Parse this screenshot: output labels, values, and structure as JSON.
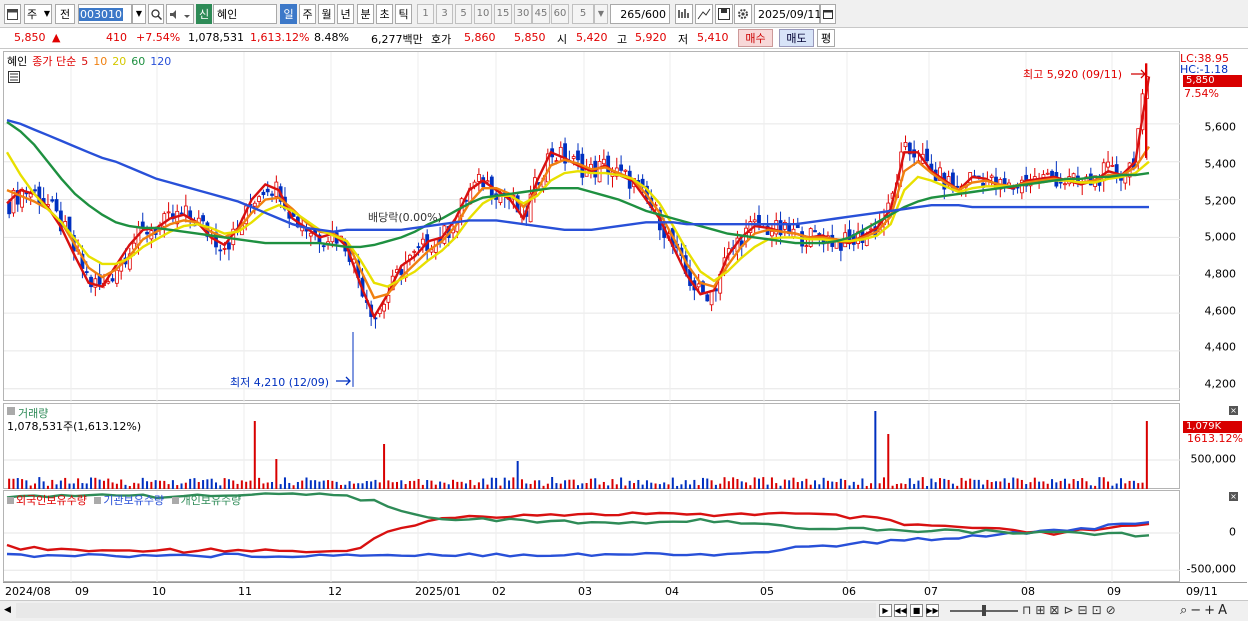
{
  "toolbar": {
    "period_sel": "주",
    "kind": "전",
    "code": "003010",
    "name": "혜인",
    "mode_new": "신",
    "periods": [
      "일",
      "주",
      "월",
      "년",
      "분",
      "초",
      "틱"
    ],
    "minutes": [
      "1",
      "3",
      "5",
      "10",
      "15",
      "30",
      "45",
      "60"
    ],
    "interval": "5",
    "count": "265",
    "count_max": "/600",
    "date": "2025/09/11"
  },
  "quote": {
    "price": "5,850",
    "arrow": "▲",
    "change": "410",
    "pct": "+7.54%",
    "volume": "1,078,531",
    "vol_pct": "1,613.12%",
    "turnover": "8.48%",
    "amount": "6,277백만",
    "ask_label": "호가",
    "ask": "5,860",
    "bid": "5,850",
    "open_label": "시",
    "open": "5,420",
    "high_label": "고",
    "high": "5,920",
    "low_label": "저",
    "low": "5,410",
    "buy_label": "매수",
    "sell_label": "매도",
    "avg_label": "평"
  },
  "price_panel": {
    "name": "혜인",
    "ma_label": "종가 단순",
    "ma_periods": [
      "5",
      "10",
      "20",
      "60",
      "120"
    ],
    "ma_colors": [
      "#d81010",
      "#f08010",
      "#e8e000",
      "#1e9040",
      "#2850d8"
    ],
    "high_annot": "최고 5,920 (09/11)",
    "low_annot": "최저 4,210 (12/09)",
    "div_annot": "배당락(0.00%)",
    "lc": "LC:38.95",
    "hc": "HC:-1.18",
    "last_tag": "5,850",
    "last_pct": "7.54%",
    "y_ticks": [
      "5,600",
      "5,400",
      "5,200",
      "5,000",
      "4,800",
      "4,600",
      "4,400",
      "4,200"
    ]
  },
  "volume_panel": {
    "title": "거래량",
    "value": "1,078,531주(1,613.12%)",
    "tag": "1,079K",
    "tag_pct": "1613.12%",
    "y_ticks": [
      "500,000"
    ]
  },
  "holdings_panel": {
    "legends": [
      "외국인보유수량",
      "기관보유수량",
      "개인보유수량"
    ],
    "colors": [
      "#d81010",
      "#2850d8",
      "#2e8b57"
    ],
    "y_ticks": [
      "0",
      "-500,000"
    ]
  },
  "x_axis": [
    "2024/08",
    "09",
    "10",
    "11",
    "12",
    "2025/01",
    "02",
    "03",
    "04",
    "05",
    "06",
    "07",
    "08",
    "09",
    "09/11"
  ],
  "colors": {
    "up": "#e00000",
    "down": "#0030c0",
    "accent_blue": "#3c78c8"
  },
  "chart_data": {
    "type": "candlestick",
    "x_range": [
      "2024/08",
      "2025/09/11"
    ],
    "y_range": [
      4130,
      5980
    ],
    "last_close": 5850,
    "high": {
      "value": 5920,
      "date": "09/11"
    },
    "low": {
      "value": 4210,
      "date": "12/09"
    },
    "ma_series": [
      {
        "name": "5",
        "color": "#d81010",
        "values": [
          5180,
          5250,
          5230,
          5160,
          5050,
          4900,
          4760,
          4740,
          4850,
          4960,
          5040,
          5050,
          5100,
          5120,
          5080,
          5000,
          4960,
          5050,
          5200,
          5280,
          5250,
          5100,
          5050,
          5000,
          5020,
          4950,
          4750,
          4580,
          4700,
          4850,
          4900,
          4980,
          5000,
          5100,
          5250,
          5300,
          5250,
          5200,
          5100,
          5300,
          5450,
          5420,
          5380,
          5350,
          5380,
          5330,
          5300,
          5200,
          5100,
          4950,
          4800,
          4700,
          4720,
          4900,
          5000,
          5060,
          5050,
          5030,
          5020,
          5000,
          5010,
          4980,
          4970,
          5010,
          5050,
          5150,
          5450,
          5450,
          5350,
          5300,
          5250,
          5320,
          5310,
          5270,
          5260,
          5300,
          5310,
          5320,
          5300,
          5280,
          5300,
          5350,
          5330,
          5400,
          5850
        ]
      },
      {
        "name": "10",
        "color": "#f08010",
        "values": [
          5250,
          5220,
          5190,
          5150,
          5080,
          4960,
          4840,
          4790,
          4830,
          4900,
          4990,
          5030,
          5070,
          5090,
          5080,
          5030,
          5000,
          5040,
          5130,
          5200,
          5210,
          5150,
          5080,
          5030,
          5020,
          4980,
          4830,
          4680,
          4700,
          4790,
          4860,
          4930,
          4980,
          5060,
          5180,
          5260,
          5260,
          5230,
          5160,
          5250,
          5380,
          5410,
          5390,
          5360,
          5370,
          5340,
          5310,
          5230,
          5130,
          5000,
          4860,
          4760,
          4740,
          4850,
          4950,
          5020,
          5040,
          5030,
          5020,
          5000,
          5000,
          4990,
          4980,
          5000,
          5030,
          5110,
          5350,
          5400,
          5340,
          5290,
          5250,
          5290,
          5300,
          5280,
          5270,
          5290,
          5300,
          5310,
          5300,
          5290,
          5300,
          5330,
          5330,
          5370,
          5480
        ]
      },
      {
        "name": "20",
        "color": "#e8e000",
        "values": [
          5450,
          5330,
          5230,
          5150,
          5080,
          4990,
          4900,
          4860,
          4860,
          4890,
          4950,
          4990,
          5030,
          5060,
          5070,
          5050,
          5020,
          5030,
          5080,
          5140,
          5170,
          5140,
          5090,
          5040,
          5010,
          4980,
          4880,
          4760,
          4740,
          4780,
          4820,
          4880,
          4930,
          5000,
          5100,
          5180,
          5220,
          5220,
          5180,
          5220,
          5300,
          5340,
          5350,
          5340,
          5340,
          5330,
          5310,
          5260,
          5180,
          5060,
          4930,
          4820,
          4770,
          4820,
          4890,
          4950,
          4990,
          5000,
          5000,
          4990,
          4990,
          4980,
          4980,
          4990,
          5010,
          5070,
          5250,
          5320,
          5300,
          5270,
          5240,
          5260,
          5270,
          5270,
          5270,
          5280,
          5290,
          5300,
          5300,
          5290,
          5290,
          5310,
          5320,
          5340,
          5400
        ]
      },
      {
        "name": "60",
        "color": "#1e9040",
        "values": [
          5610,
          5560,
          5490,
          5400,
          5310,
          5230,
          5170,
          5120,
          5080,
          5060,
          5050,
          5050,
          5040,
          5030,
          5020,
          5010,
          5000,
          4990,
          4980,
          4970,
          4970,
          4970,
          4970,
          4970,
          4960,
          4950,
          4950,
          4960,
          4980,
          5000,
          5030,
          5070,
          5100,
          5140,
          5180,
          5210,
          5220,
          5230,
          5240,
          5250,
          5260,
          5260,
          5260,
          5240,
          5220,
          5200,
          5170,
          5140,
          5120,
          5100,
          5080,
          5060,
          5040,
          5020,
          5010,
          5000,
          4990,
          4980,
          4970,
          4970,
          4970,
          4980,
          5000,
          5040,
          5080,
          5120,
          5160,
          5190,
          5210,
          5220,
          5230,
          5240,
          5250,
          5260,
          5270,
          5280,
          5290,
          5300,
          5310,
          5310,
          5320,
          5320,
          5330,
          5330,
          5340
        ]
      },
      {
        "name": "120",
        "color": "#2850d8",
        "values": [
          5620,
          5600,
          5570,
          5540,
          5510,
          5480,
          5450,
          5420,
          5400,
          5370,
          5340,
          5310,
          5290,
          5270,
          5250,
          5230,
          5210,
          5190,
          5160,
          5130,
          5100,
          5070,
          5050,
          5040,
          5030,
          5040,
          5040,
          5040,
          5040,
          5040,
          5050,
          5060,
          5070,
          5080,
          5090,
          5090,
          5090,
          5080,
          5070,
          5060,
          5050,
          5040,
          5040,
          5040,
          5050,
          5060,
          5070,
          5080,
          5080,
          5080,
          5070,
          5070,
          5070,
          5070,
          5070,
          5070,
          5070,
          5070,
          5070,
          5080,
          5090,
          5100,
          5110,
          5120,
          5130,
          5140,
          5150,
          5160,
          5170,
          5170,
          5170,
          5160,
          5160,
          5160,
          5160,
          5160,
          5160,
          5160,
          5160,
          5160,
          5160,
          5160,
          5160,
          5160,
          5160
        ]
      }
    ],
    "holdings_series": [
      {
        "name": "외국인보유수량",
        "values": [
          -150,
          -160,
          -170,
          -180,
          -175,
          -180,
          -190,
          -200,
          -195,
          -185,
          -180,
          -175,
          -185,
          -190,
          -180,
          -170,
          -180,
          -185,
          -190,
          -185,
          -180,
          -190,
          -200,
          -205,
          -210,
          -200,
          -160,
          -80,
          0,
          50,
          100,
          140,
          150,
          160,
          170,
          180,
          185,
          190,
          195,
          200,
          205,
          205,
          200,
          195,
          200,
          205,
          210,
          205,
          200,
          195,
          190,
          190,
          195,
          200,
          205,
          210,
          210,
          205,
          200,
          195,
          190,
          180,
          170,
          160,
          150,
          120,
          90,
          80,
          75,
          70,
          60,
          55,
          40,
          30,
          20,
          10,
          0,
          -10,
          0,
          20,
          40,
          50,
          60,
          70,
          80
        ]
      },
      {
        "name": "기관보유수량",
        "values": [
          -240,
          -240,
          -240,
          -240,
          -240,
          -240,
          -240,
          -240,
          -240,
          -240,
          -240,
          -240,
          -240,
          -240,
          -240,
          -240,
          -240,
          -240,
          -240,
          -240,
          -240,
          -240,
          -240,
          -240,
          -240,
          -240,
          -235,
          -230,
          -230,
          -230,
          -230,
          -230,
          -230,
          -230,
          -230,
          -230,
          -230,
          -230,
          -230,
          -230,
          -230,
          -230,
          -230,
          -230,
          -230,
          -230,
          -230,
          -230,
          -230,
          -230,
          -230,
          -230,
          -230,
          -230,
          -225,
          -210,
          -190,
          -170,
          -160,
          -150,
          -140,
          -130,
          -120,
          -110,
          -100,
          -90,
          -80,
          -70,
          -60,
          -50,
          -40,
          -30,
          -20,
          -10,
          0,
          10,
          20,
          30,
          40,
          50,
          60,
          70,
          80,
          90,
          100
        ]
      },
      {
        "name": "개인보유수량",
        "values": [
          390,
          395,
          400,
          405,
          400,
          395,
          400,
          405,
          410,
          405,
          400,
          395,
          400,
          405,
          400,
          395,
          400,
          405,
          410,
          405,
          400,
          405,
          410,
          405,
          400,
          390,
          370,
          340,
          300,
          250,
          210,
          180,
          170,
          160,
          150,
          145,
          140,
          135,
          130,
          125,
          120,
          118,
          115,
          112,
          110,
          108,
          110,
          115,
          120,
          125,
          128,
          130,
          128,
          125,
          120,
          110,
          95,
          80,
          70,
          60,
          55,
          50,
          45,
          40,
          35,
          30,
          28,
          26,
          24,
          22,
          20,
          18,
          16,
          14,
          12,
          10,
          8,
          6,
          4,
          2,
          0,
          -5,
          -10,
          -20,
          -40
        ]
      }
    ]
  }
}
